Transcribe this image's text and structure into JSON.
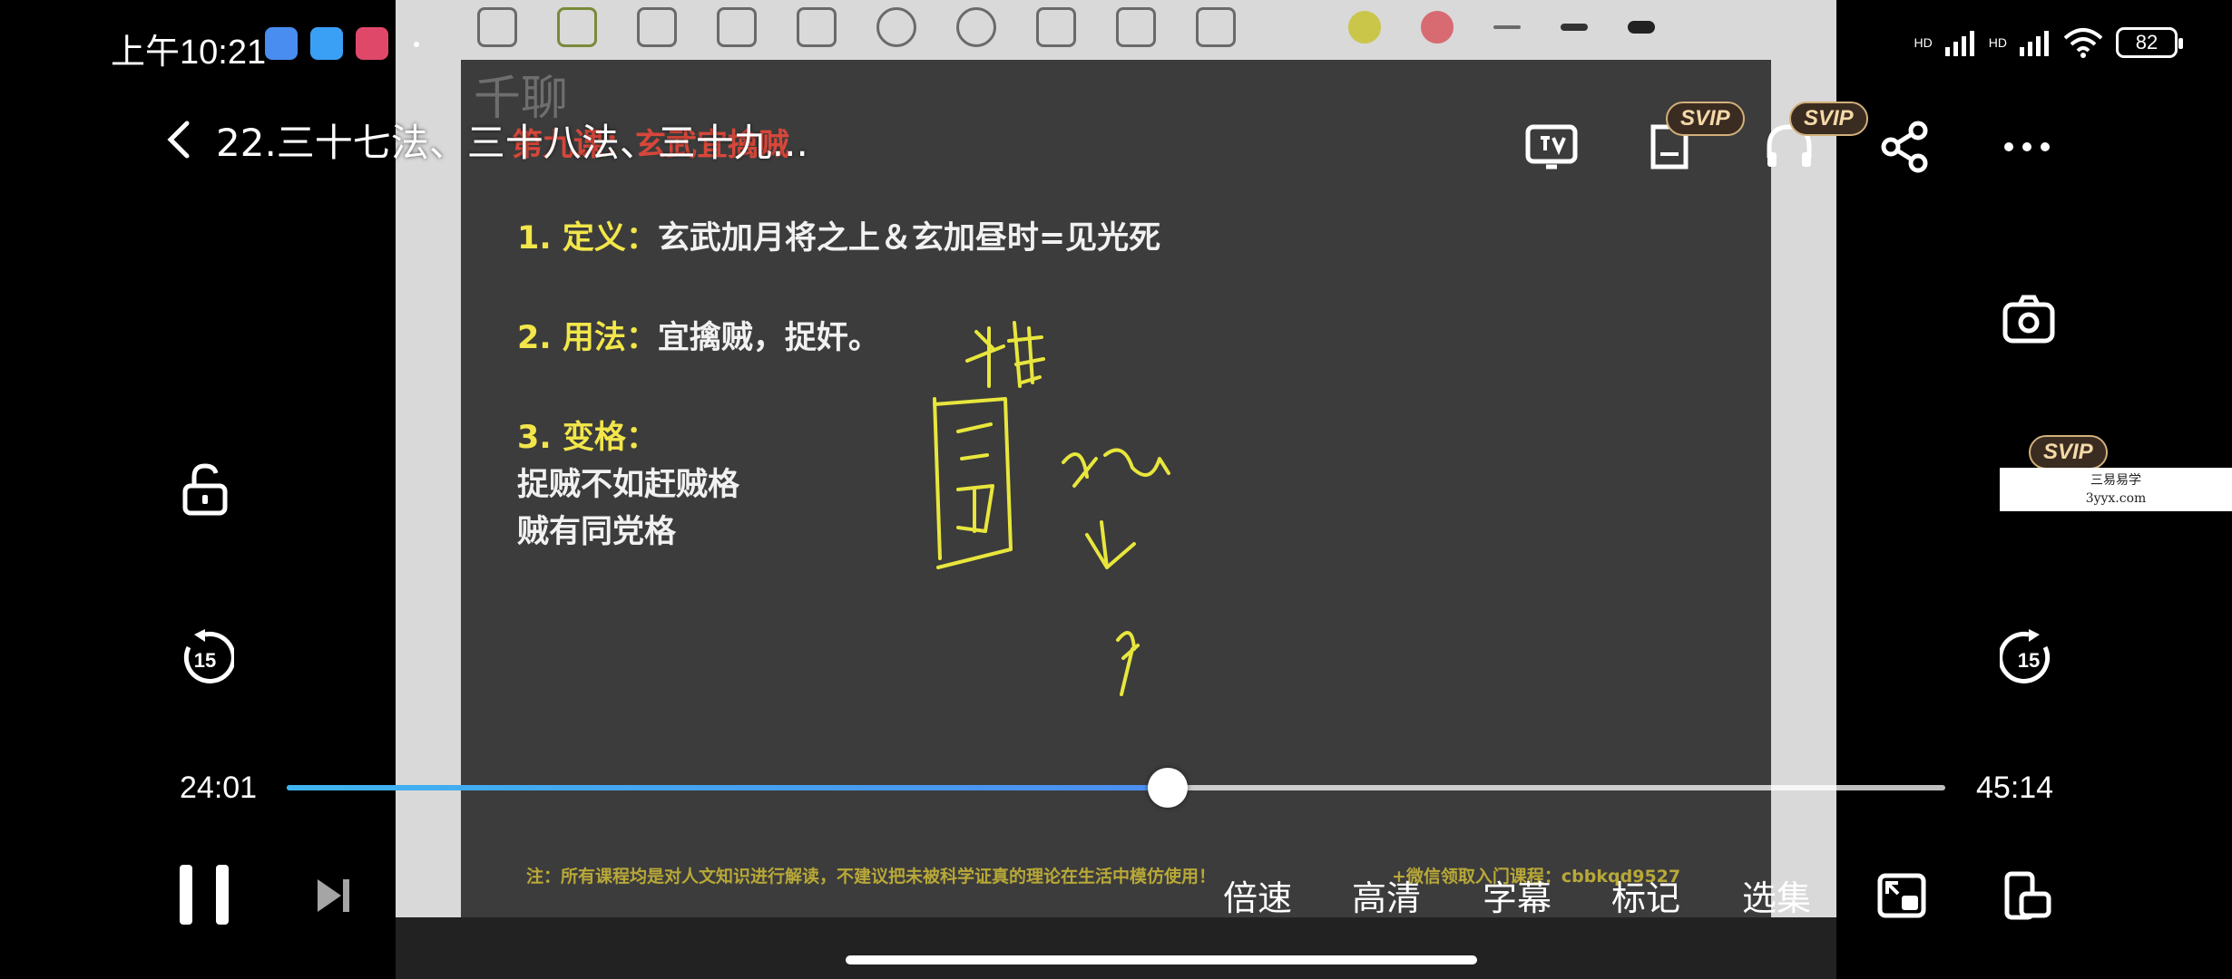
{
  "status_bar": {
    "time": "上午10:21",
    "battery": "82",
    "signal_label_1": "HD",
    "signal_label_2": "HD"
  },
  "top_bar": {
    "title": "22.三十七法、三十八法、三十九..."
  },
  "badges": {
    "svip": "SVIP"
  },
  "slide": {
    "watermark": "千聊",
    "heading": "第九课：玄武宜擒贼",
    "line1_key": "1. 定义：",
    "line1_val": "玄武加月将之上＆玄加昼时=见光死",
    "line2_key": "2. 用法：",
    "line2_val": "宜擒贼，捉奸。",
    "line3_key": "3. 变格：",
    "line4": "捉贼不如赶贼格",
    "line5": "贼有同党格",
    "footnote": "注：所有课程均是对人文知识进行解读，不建议把未被科学证真的理论在生活中模仿使用！",
    "footnote2": "+微信领取入门课程：cbbkqd9527"
  },
  "player": {
    "current_time": "24:01",
    "total_time": "45:14",
    "progress_fraction": 0.531
  },
  "bottom_bar": {
    "speed": "倍速",
    "quality": "高清",
    "subtitles": "字幕",
    "bookmark": "标记",
    "episodes": "选集"
  },
  "watermark": {
    "line1": "三易易学",
    "line2": "3yyx.com"
  },
  "colors": {
    "accent": "#4c8ef0",
    "slide_bg": "#3c3c3c",
    "slide_key": "#f2e64a",
    "svip_gold": "#d2b07a"
  }
}
